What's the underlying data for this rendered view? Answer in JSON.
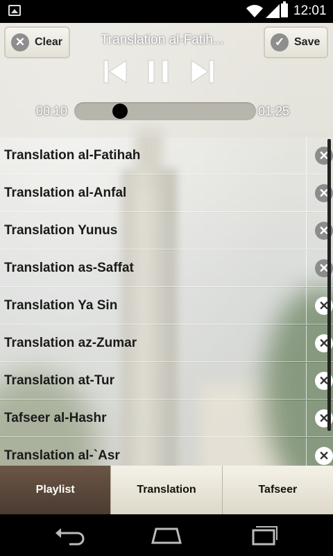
{
  "status_bar": {
    "time": "12:01"
  },
  "player": {
    "clear_label": "Clear",
    "save_label": "Save",
    "now_playing": "Translation al-Fatih...",
    "elapsed": "00:10",
    "duration": "01:25",
    "progress": 0.12
  },
  "playlist": {
    "items": [
      {
        "label": "Translation al-Fatihah"
      },
      {
        "label": "Translation al-Anfal"
      },
      {
        "label": "Translation Yunus"
      },
      {
        "label": "Translation as-Saffat"
      },
      {
        "label": "Translation Ya Sin"
      },
      {
        "label": "Translation az-Zumar"
      },
      {
        "label": "Translation at-Tur"
      },
      {
        "label": "Tafseer al-Hashr"
      },
      {
        "label": "Translation al-`Asr"
      }
    ]
  },
  "tabs": [
    {
      "label": "Playlist",
      "active": true
    },
    {
      "label": "Translation",
      "active": false
    },
    {
      "label": "Tafseer",
      "active": false
    }
  ],
  "icons": {
    "clear": "close-circle-icon",
    "save": "check-circle-icon",
    "delete": "close-circle-icon",
    "prev": "skip-previous-icon",
    "pause": "pause-icon",
    "next": "skip-next-icon",
    "back": "back-icon",
    "home": "home-icon",
    "recents": "recents-icon"
  }
}
